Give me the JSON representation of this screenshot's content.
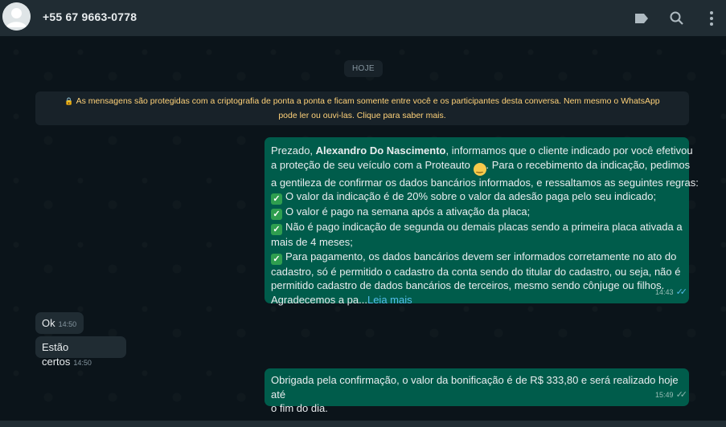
{
  "header": {
    "contact": "+55 67 9663-0778",
    "icons": [
      "avatar-icon",
      "label-icon",
      "search-icon",
      "menu-icon"
    ]
  },
  "chat": {
    "date_chip": "HOJE",
    "encryption_line1": "As mensagens são protegidas com a criptografia de ponta a ponta e ficam somente entre você e os participantes desta conversa. Nem mesmo o WhatsApp",
    "encryption_line2": "pode ler ou ouvi-las. Clique para saber mais.",
    "messages": [
      {
        "p1_before": "Prezado, ",
        "p1_name": "Alexandro Do Nascimento",
        "p1_after": ", informamos que o cliente indicado por você efetivou",
        "l2": "a proteção de seu veículo com a Proteauto ",
        "l2b": ". Para o recebimento da indicação, pedimos",
        "l3": "a gentileza de confirmar os dados bancários informados, e ressaltamos as seguintes regras:",
        "r1": "O valor da indicação é de 20% sobre o valor da adesão paga pelo seu indicado;",
        "r2": "O valor é pago na semana após a ativação da placa;",
        "r3a": "Não é pago indicação de segunda ou demais placas sendo a primeira placa ativada a",
        "r3b": "mais de 4 meses;",
        "r4a": "Para pagamento, os dados bancários devem ser informados corretamente no ato do",
        "r4b": "cadastro, só é permitido o cadastro da conta sendo do titular do cadastro, ou seja, não é",
        "r4c": "permitido cadastro de dados bancários de terceiros, mesmo sendo cônjuge ou filhos.",
        "r4d": "Agradecemos a pa...",
        "readmore": "Leia mais",
        "time": "14:43"
      },
      {
        "text": "Ok",
        "time": "14:50"
      },
      {
        "text": "Estão certos",
        "time": "14:50"
      },
      {
        "l1": "Obrigada pela confirmação, o valor da bonificação é de R$ 333,80 e será realizado hoje até",
        "l2": "o fim do dia.",
        "time": "15:49"
      }
    ]
  }
}
